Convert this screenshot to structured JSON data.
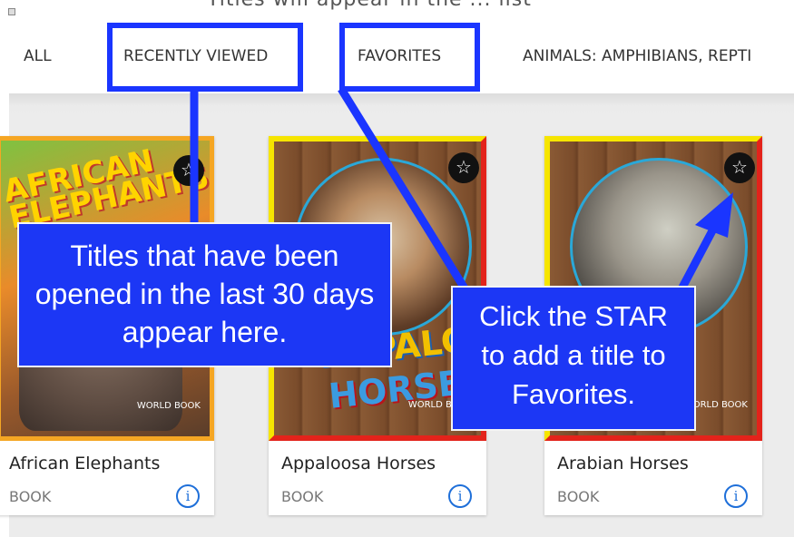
{
  "header": {
    "cutoff_text": "Titles will appear in the ... list"
  },
  "tabs": [
    {
      "label": "ALL"
    },
    {
      "label": "RECENTLY VIEWED"
    },
    {
      "label": "FAVORITES"
    },
    {
      "label": "ANIMALS: AMPHIBIANS, REPTI"
    }
  ],
  "cards": [
    {
      "title": "African Elephants",
      "type": "BOOK",
      "cover_title": "AFRICAN ELEPHANTS",
      "publisher": "WORLD BOOK"
    },
    {
      "title": "Appaloosa Horses",
      "type": "BOOK",
      "cover_title": "APPALOOSA",
      "cover_sub": "HORSES",
      "publisher": "WORLD BOOK"
    },
    {
      "title": "Arabian Horses",
      "type": "BOOK",
      "publisher": "WORLD BOOK"
    }
  ],
  "icons": {
    "star": "☆",
    "info": "i"
  },
  "callouts": {
    "recent": [
      "Titles that have been",
      "opened in the last 30 days",
      "appear here."
    ],
    "star": [
      "Click the STAR",
      "to add a title to",
      "Favorites."
    ]
  },
  "colors": {
    "annotation_blue": "#1a35ff",
    "info_blue": "#1e6fd9"
  }
}
